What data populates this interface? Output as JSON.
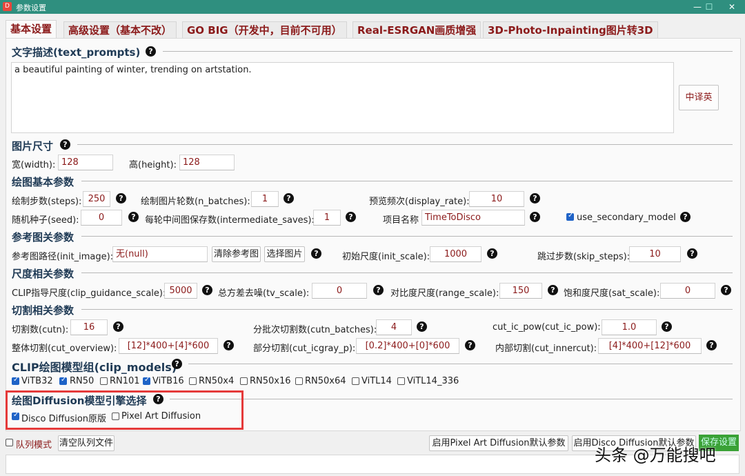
{
  "window": {
    "icon": "app-icon",
    "title": "参数设置",
    "controls": {
      "minimize": "—",
      "maximize": "☐",
      "close": "✕"
    }
  },
  "tabs": [
    {
      "label": "基本设置",
      "active": true
    },
    {
      "label": "高级设置（基本不改）"
    },
    {
      "label": "GO BIG（开发中，目前不可用）"
    },
    {
      "label": "Real-ESRGAN画质增强"
    },
    {
      "label": "3D-Photo-Inpainting图片转3D"
    }
  ],
  "text_prompts": {
    "heading": "文字描述(text_prompts)",
    "value": "a beautiful painting of winter, trending on artstation.",
    "translate_button": "中译英"
  },
  "image_size": {
    "heading": "图片尺寸",
    "width_label": "宽(width):",
    "width": "128",
    "height_label": "高(height):",
    "height": "128"
  },
  "basic": {
    "heading": "绘图基本参数",
    "steps_label": "绘制步数(steps):",
    "steps": "250",
    "n_batches_label": "绘制图片轮数(n_batches):",
    "n_batches": "1",
    "display_rate_label": "预览频次(display_rate):",
    "display_rate": "10",
    "seed_label": "随机种子(seed):",
    "seed": "0",
    "intermediate_label": "每轮中间图保存数(intermediate_saves):",
    "intermediate": "1",
    "project_label": "项目名称",
    "project": "TimeToDisco",
    "secondary_label": "use_secondary_model",
    "secondary": true
  },
  "reference": {
    "heading": "参考图关参数",
    "init_image_label": "参考图路径(init_image):",
    "init_image": "无(null)",
    "clear_button": "清除参考图",
    "choose_button": "选择图片",
    "init_scale_label": "初始尺度(init_scale):",
    "init_scale": "1000",
    "skip_steps_label": "跳过步数(skip_steps):",
    "skip_steps": "10"
  },
  "scale": {
    "heading": "尺度相关参数",
    "clip_label": "CLIP指导尺度(clip_guidance_scale):",
    "clip": "5000",
    "tv_label": "总方差去噪(tv_scale):",
    "tv": "0",
    "range_label": "对比度尺度(range_scale):",
    "range": "150",
    "sat_label": "饱和度尺度(sat_scale):",
    "sat": "0"
  },
  "cut": {
    "heading": "切割相关参数",
    "cutn_label": "切割数(cutn):",
    "cutn": "16",
    "cutn_batches_label": "分批次切割数(cutn_batches):",
    "cutn_batches": "4",
    "cut_ic_pow_label": "cut_ic_pow(cut_ic_pow):",
    "cut_ic_pow": "1.0",
    "overview_label": "整体切割(cut_overview):",
    "overview": "[12]*400+[4]*600",
    "icgray_label": "部分切割(cut_icgray_p):",
    "icgray": "[0.2]*400+[0]*600",
    "innercut_label": "内部切割(cut_innercut):",
    "innercut": "[4]*400+[12]*600"
  },
  "clip_models": {
    "heading": "CLIP绘图模型组(clip_models)",
    "items": [
      {
        "label": "ViTB32",
        "checked": true
      },
      {
        "label": "RN50",
        "checked": true
      },
      {
        "label": "RN101",
        "checked": false
      },
      {
        "label": "ViTB16",
        "checked": true
      },
      {
        "label": "RN50x4",
        "checked": false
      },
      {
        "label": "RN50x16",
        "checked": false
      },
      {
        "label": "RN50x64",
        "checked": false
      },
      {
        "label": "ViTL14",
        "checked": false
      },
      {
        "label": "ViTL14_336",
        "checked": false
      }
    ]
  },
  "diffusion": {
    "heading": "绘图Diffusion模型引擎选择",
    "disco_label": "Disco Diffusion原版",
    "disco": true,
    "pixel_label": "Pixel Art Diffusion",
    "pixel": false
  },
  "bottom": {
    "queue_label": "队列模式",
    "queue": false,
    "clear_queue_button": "清空队列文件",
    "pixel_defaults_button": "启用Pixel Art Diffusion默认参数",
    "disco_defaults_button": "启用Disco Diffusion默认参数",
    "save_button": "保存设置",
    "watermark": "头条 @万能搜吧"
  },
  "help_icon": "?"
}
